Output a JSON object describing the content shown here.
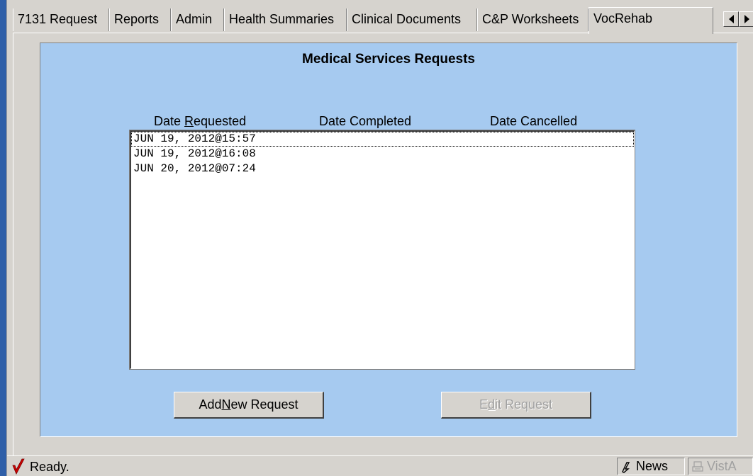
{
  "tabs": [
    {
      "label": "7131 Request",
      "active": false
    },
    {
      "label": "Reports",
      "active": false
    },
    {
      "label": "Admin",
      "active": false
    },
    {
      "label": "Health Summaries",
      "active": false
    },
    {
      "label": "Clinical Documents",
      "active": false
    },
    {
      "label": "C&P Worksheets",
      "active": false
    },
    {
      "label": "VocRehab",
      "active": true
    }
  ],
  "panel": {
    "title": "Medical Services Requests",
    "columns": {
      "requested_prefix": "Date ",
      "requested_accel": "R",
      "requested_suffix": "equested",
      "completed": "Date Completed",
      "cancelled": "Date Cancelled"
    },
    "rows": [
      {
        "requested": "JUN 19, 2012@15:57",
        "completed": "",
        "cancelled": ""
      },
      {
        "requested": "JUN 19, 2012@16:08",
        "completed": "",
        "cancelled": ""
      },
      {
        "requested": "JUN 20, 2012@07:24",
        "completed": "",
        "cancelled": ""
      }
    ],
    "add_button": {
      "prefix": "Add ",
      "accel": "N",
      "suffix": "ew Request"
    },
    "edit_button": {
      "prefix": "E",
      "accel": "d",
      "suffix": "it Request"
    }
  },
  "statusbar": {
    "status": "Ready.",
    "news": "News",
    "vista": "VistA"
  },
  "colors": {
    "panel_bg": "#a6caf0",
    "window_bg": "#d6d3ce",
    "check_red": "#cc0000"
  },
  "icons": [
    "arrow-left-icon",
    "arrow-right-icon",
    "red-check-icon",
    "news-icon",
    "vista-icon"
  ]
}
